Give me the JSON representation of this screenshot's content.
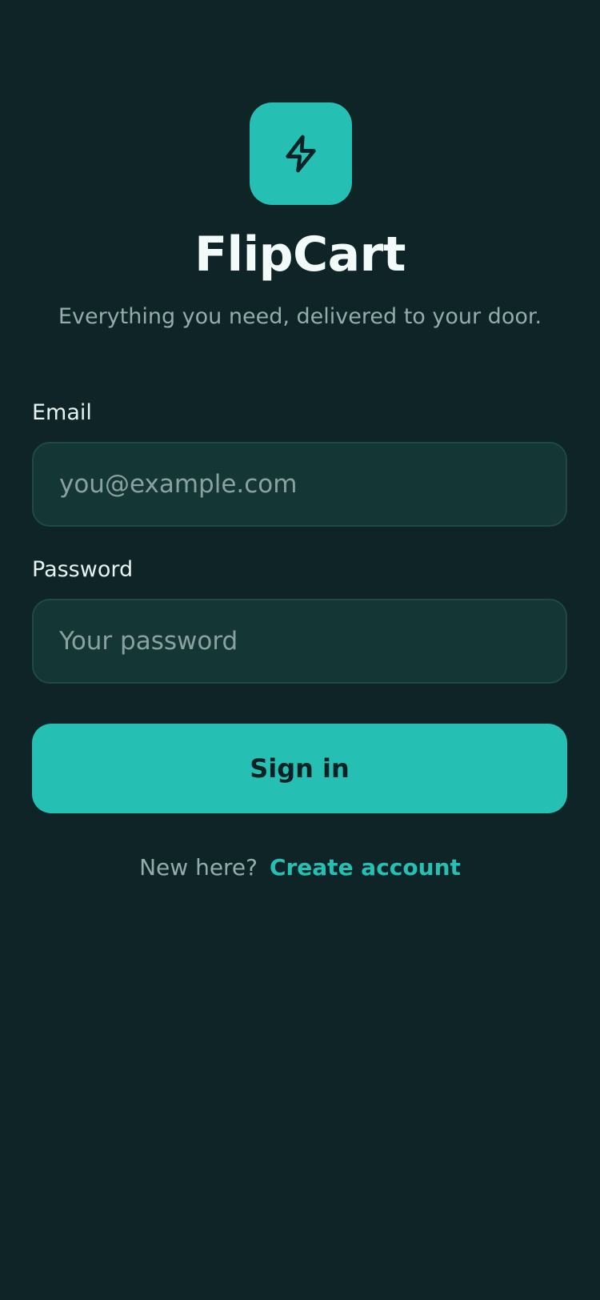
{
  "app": {
    "name": "FlipCart",
    "tagline": "Everything you need, delivered to your door.",
    "logo_icon": "lightning-bolt-icon"
  },
  "form": {
    "email": {
      "label": "Email",
      "value": "",
      "placeholder": "you@example.com"
    },
    "password": {
      "label": "Password",
      "value": "",
      "placeholder": "Your password"
    },
    "submit_label": "Sign in"
  },
  "footer": {
    "prompt": "New here?",
    "link_label": "Create account"
  },
  "colors": {
    "background": "#0e2426",
    "accent": "#26bfb3",
    "field_background": "#143736",
    "muted_text": "#93aeaa"
  }
}
